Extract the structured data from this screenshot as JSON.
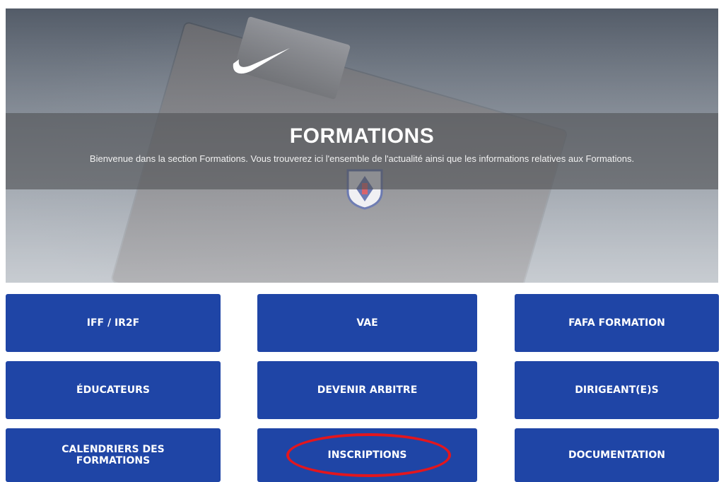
{
  "hero": {
    "title": "FORMATIONS",
    "subtitle": "Bienvenue dans la section Formations. Vous trouverez ici l'ensemble de l'actualité ainsi que les informations relatives aux Formations."
  },
  "tiles": [
    {
      "label": "IFF / IR2F"
    },
    {
      "label": "VAE"
    },
    {
      "label": "FAFA FORMATION"
    },
    {
      "label": "ÉDUCATEURS"
    },
    {
      "label": "DEVENIR ARBITRE"
    },
    {
      "label": "DIRIGEANT(E)S"
    },
    {
      "label": "CALENDRIERS DES FORMATIONS"
    },
    {
      "label": "INSCRIPTIONS"
    },
    {
      "label": "DOCUMENTATION"
    }
  ],
  "colors": {
    "tile_blue": "#1f45a6",
    "highlight_red": "#e3161d",
    "banner_overlay": "#505256"
  },
  "icons": [
    "nike-swoosh-icon",
    "fff-crest-icon"
  ]
}
